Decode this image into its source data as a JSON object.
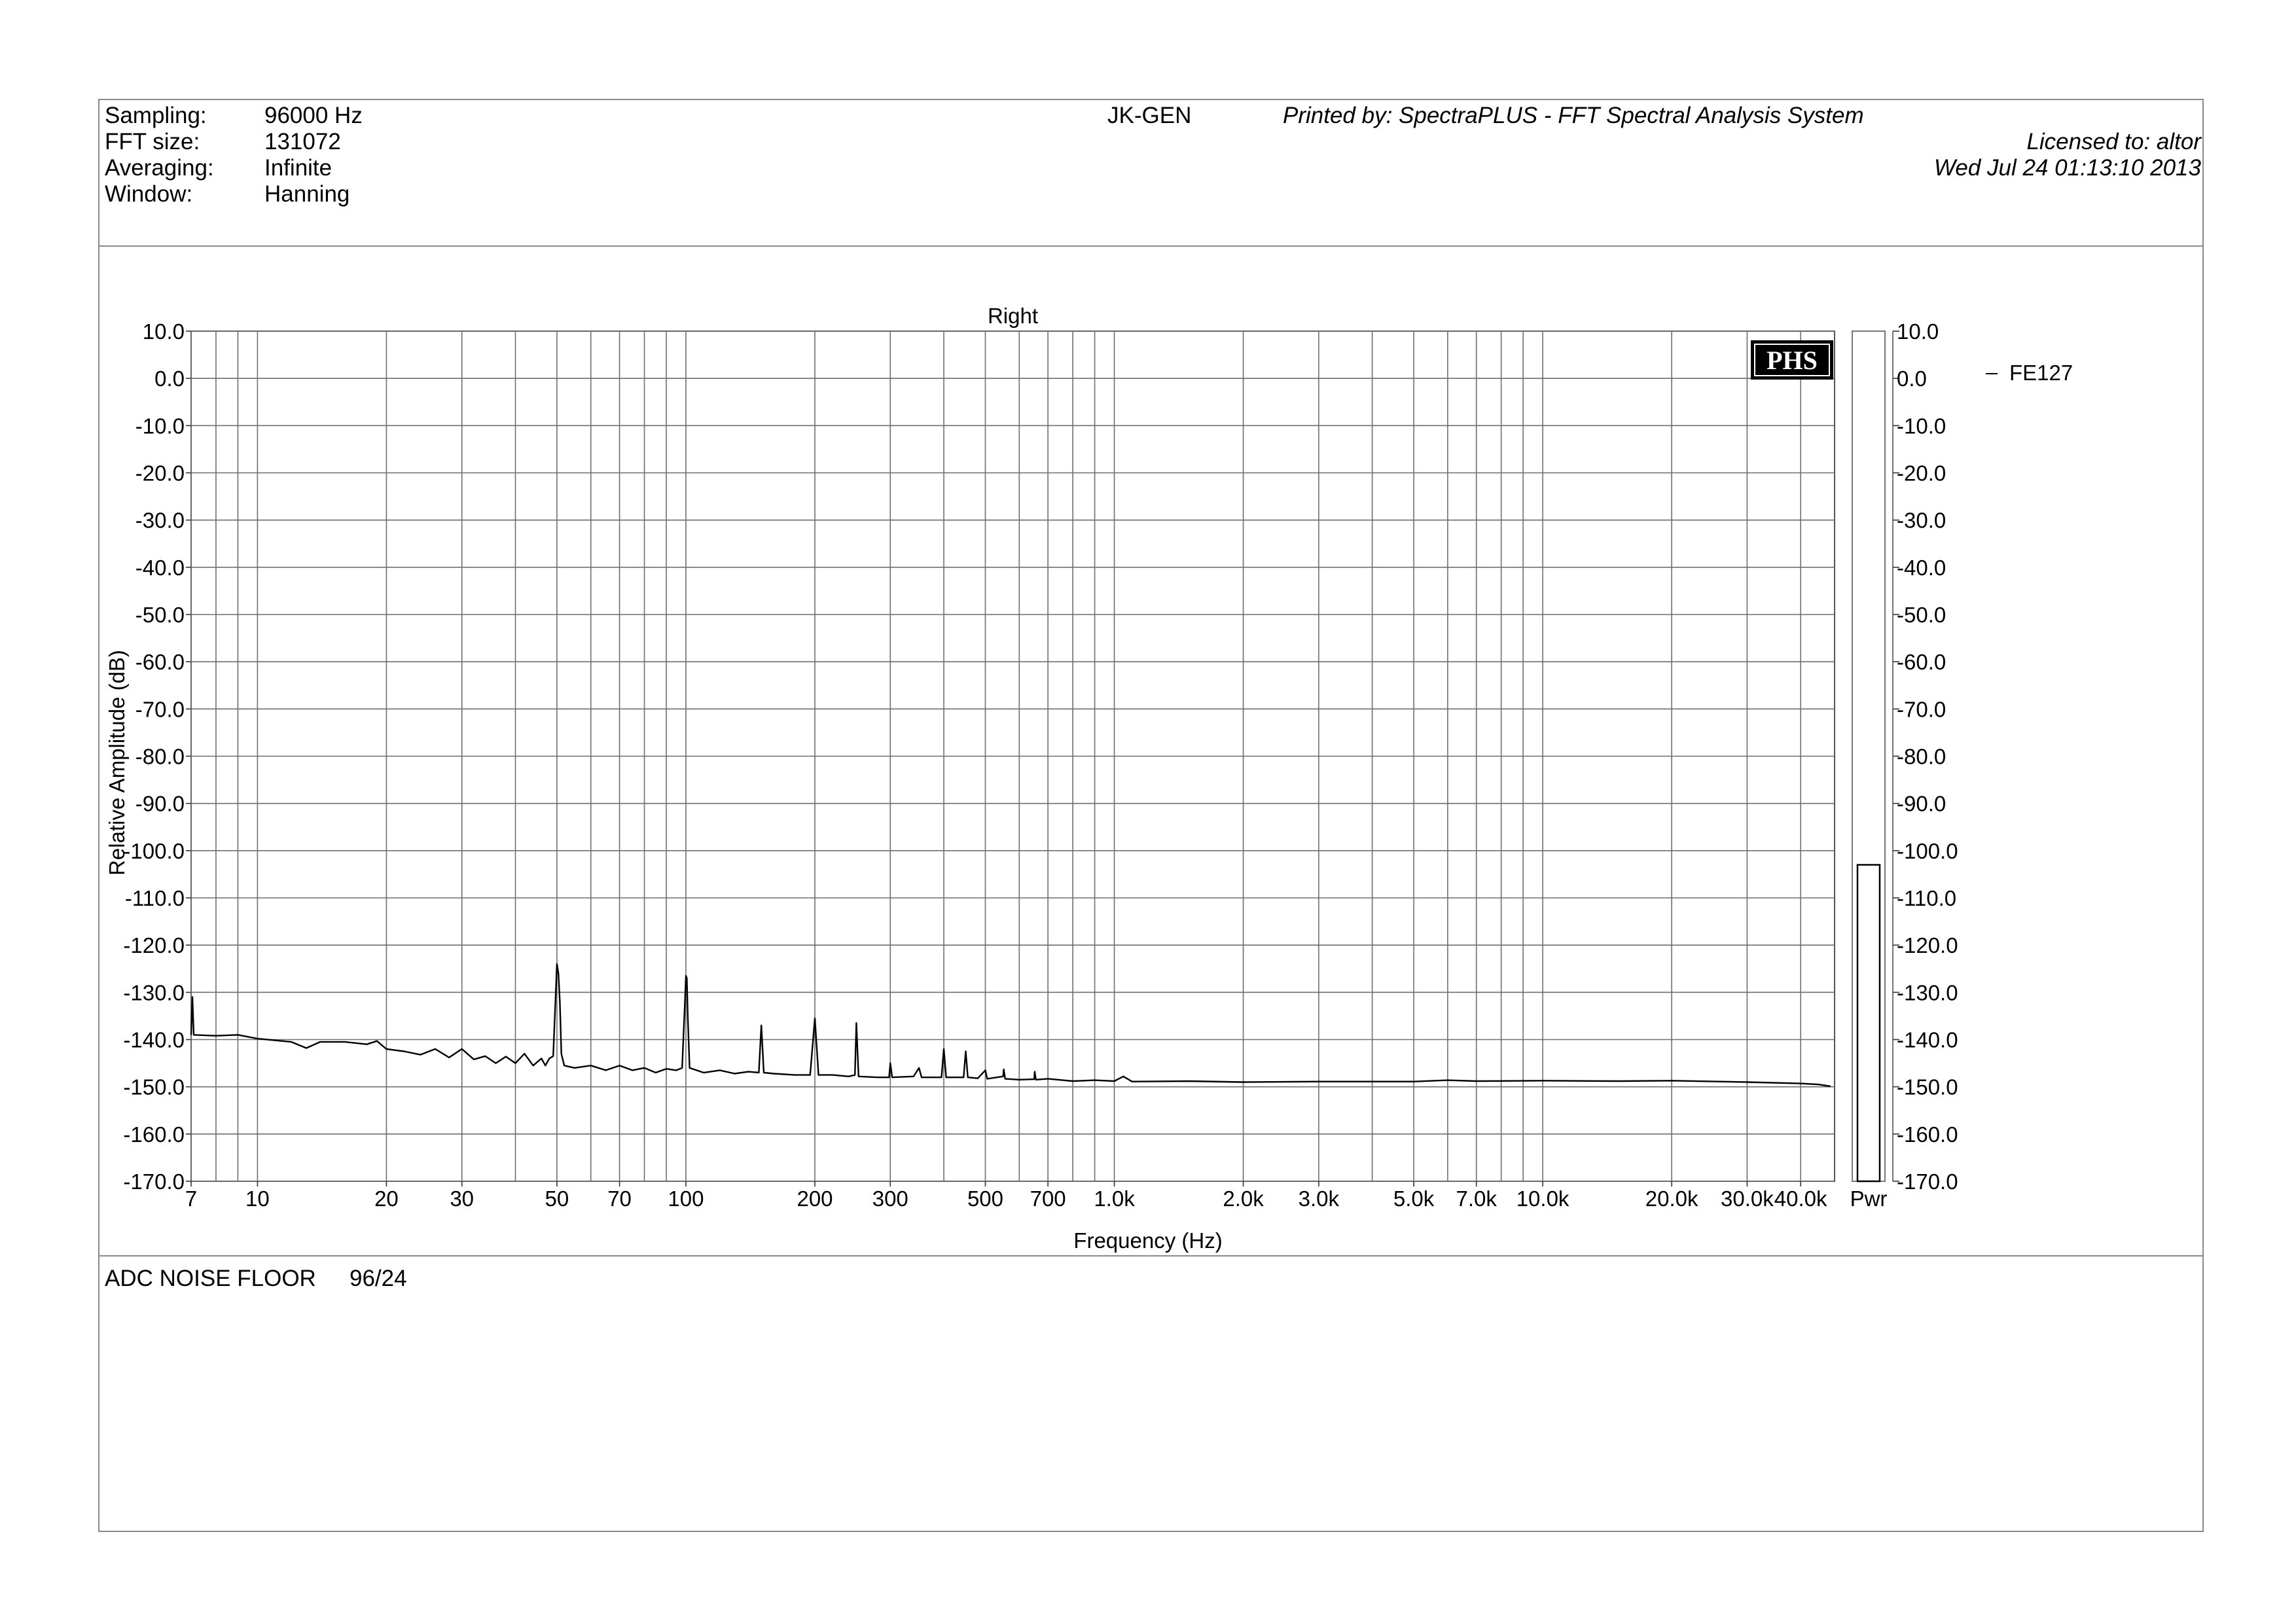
{
  "header": {
    "settings": [
      {
        "label": "Sampling:",
        "value": "96000 Hz"
      },
      {
        "label": "FFT size:",
        "value": "131072"
      },
      {
        "label": "Averaging:",
        "value": "Infinite"
      },
      {
        "label": "Window:",
        "value": "Hanning"
      }
    ],
    "device": "JK-GEN",
    "printed_by": "Printed by: SpectraPLUS - FFT Spectral Analysis System",
    "licensed_to": "Licensed to: altor",
    "timestamp": "Wed Jul 24 01:13:10 2013"
  },
  "footer": {
    "comment_label": "ADC NOISE FLOOR",
    "comment_value": "96/24"
  },
  "logo_text": "PHS",
  "chart_data": {
    "type": "line",
    "title": "Right",
    "xlabel": "Frequency (Hz)",
    "ylabel": "Relative Amplitude (dB)",
    "xscale": "log",
    "xlim": [
      7,
      48000
    ],
    "ylim": [
      -170,
      10
    ],
    "x_ticks": [
      {
        "v": 7,
        "label": "7"
      },
      {
        "v": 10,
        "label": "10"
      },
      {
        "v": 20,
        "label": "20"
      },
      {
        "v": 30,
        "label": "30"
      },
      {
        "v": 50,
        "label": "50"
      },
      {
        "v": 70,
        "label": "70"
      },
      {
        "v": 100,
        "label": "100"
      },
      {
        "v": 200,
        "label": "200"
      },
      {
        "v": 300,
        "label": "300"
      },
      {
        "v": 500,
        "label": "500"
      },
      {
        "v": 700,
        "label": "700"
      },
      {
        "v": 1000,
        "label": "1.0k"
      },
      {
        "v": 2000,
        "label": "2.0k"
      },
      {
        "v": 3000,
        "label": "3.0k"
      },
      {
        "v": 5000,
        "label": "5.0k"
      },
      {
        "v": 7000,
        "label": "7.0k"
      },
      {
        "v": 10000,
        "label": "10.0k"
      },
      {
        "v": 20000,
        "label": "20.0k"
      },
      {
        "v": 30000,
        "label": "30.0k"
      },
      {
        "v": 40000,
        "label": "40.0k"
      }
    ],
    "x_gridlines": [
      7,
      8,
      9,
      10,
      20,
      30,
      40,
      50,
      60,
      70,
      80,
      90,
      100,
      200,
      300,
      400,
      500,
      600,
      700,
      800,
      900,
      1000,
      2000,
      3000,
      4000,
      5000,
      6000,
      7000,
      8000,
      9000,
      10000,
      20000,
      30000,
      40000
    ],
    "y_ticks": [
      "10.0",
      "0.0",
      "-10.0",
      "-20.0",
      "-30.0",
      "-40.0",
      "-50.0",
      "-60.0",
      "-70.0",
      "-80.0",
      "-90.0",
      "-100.0",
      "-110.0",
      "-120.0",
      "-130.0",
      "-140.0",
      "-150.0",
      "-160.0",
      "-170.0"
    ],
    "grid": true,
    "legend": {
      "position": "right",
      "entries": [
        "FE127"
      ]
    },
    "series": [
      {
        "name": "FE127",
        "color": "#000000",
        "points": [
          [
            7,
            -139
          ],
          [
            7.05,
            -131
          ],
          [
            7.1,
            -139
          ],
          [
            8,
            -139.2
          ],
          [
            9,
            -139
          ],
          [
            10,
            -139.8
          ],
          [
            12,
            -140.5
          ],
          [
            13,
            -141.8
          ],
          [
            14,
            -140.5
          ],
          [
            16,
            -140.5
          ],
          [
            18,
            -141
          ],
          [
            19,
            -140.3
          ],
          [
            20,
            -142
          ],
          [
            22,
            -142.5
          ],
          [
            24,
            -143.2
          ],
          [
            26,
            -142
          ],
          [
            28,
            -143.8
          ],
          [
            30,
            -142
          ],
          [
            32,
            -144.2
          ],
          [
            34,
            -143.5
          ],
          [
            36,
            -145
          ],
          [
            38,
            -143.6
          ],
          [
            40,
            -145
          ],
          [
            42,
            -143
          ],
          [
            44,
            -145.5
          ],
          [
            46,
            -144
          ],
          [
            47,
            -145.5
          ],
          [
            48,
            -144
          ],
          [
            49,
            -143.5
          ],
          [
            49.6,
            -132
          ],
          [
            50,
            -124
          ],
          [
            50.4,
            -126
          ],
          [
            50.8,
            -132
          ],
          [
            51.2,
            -143
          ],
          [
            52,
            -145.5
          ],
          [
            55,
            -146
          ],
          [
            60,
            -145.5
          ],
          [
            65,
            -146.5
          ],
          [
            70,
            -145.5
          ],
          [
            75,
            -146.5
          ],
          [
            80,
            -146
          ],
          [
            85,
            -147
          ],
          [
            90,
            -146.2
          ],
          [
            95,
            -146.5
          ],
          [
            98,
            -146
          ],
          [
            99.5,
            -132
          ],
          [
            100,
            -126.5
          ],
          [
            100.5,
            -127
          ],
          [
            101,
            -135
          ],
          [
            102,
            -146
          ],
          [
            110,
            -147
          ],
          [
            120,
            -146.5
          ],
          [
            130,
            -147.2
          ],
          [
            140,
            -146.8
          ],
          [
            148,
            -147
          ],
          [
            150,
            -137
          ],
          [
            152,
            -147
          ],
          [
            160,
            -147.2
          ],
          [
            180,
            -147.5
          ],
          [
            195,
            -147.5
          ],
          [
            200,
            -135.5
          ],
          [
            204,
            -147.5
          ],
          [
            220,
            -147.5
          ],
          [
            240,
            -147.8
          ],
          [
            248,
            -147.5
          ],
          [
            250,
            -136.5
          ],
          [
            253,
            -147.8
          ],
          [
            280,
            -148
          ],
          [
            298,
            -148
          ],
          [
            300,
            -145
          ],
          [
            303,
            -148
          ],
          [
            340,
            -147.8
          ],
          [
            350,
            -146
          ],
          [
            355,
            -148
          ],
          [
            395,
            -148
          ],
          [
            400,
            -142
          ],
          [
            405,
            -148
          ],
          [
            445,
            -148
          ],
          [
            450,
            -142.5
          ],
          [
            455,
            -148
          ],
          [
            480,
            -148.2
          ],
          [
            500,
            -146.5
          ],
          [
            505,
            -148.3
          ],
          [
            550,
            -147.8
          ],
          [
            552,
            -146.3
          ],
          [
            556,
            -148.3
          ],
          [
            600,
            -148.5
          ],
          [
            650,
            -148.4
          ],
          [
            652,
            -146.8
          ],
          [
            656,
            -148.5
          ],
          [
            700,
            -148.3
          ],
          [
            800,
            -148.8
          ],
          [
            900,
            -148.6
          ],
          [
            1000,
            -148.8
          ],
          [
            1050,
            -147.8
          ],
          [
            1100,
            -148.9
          ],
          [
            1500,
            -148.8
          ],
          [
            2000,
            -149
          ],
          [
            3000,
            -148.9
          ],
          [
            5000,
            -148.9
          ],
          [
            6000,
            -148.6
          ],
          [
            7000,
            -148.8
          ],
          [
            10000,
            -148.7
          ],
          [
            15000,
            -148.8
          ],
          [
            20000,
            -148.7
          ],
          [
            30000,
            -149
          ],
          [
            40000,
            -149.3
          ],
          [
            44000,
            -149.5
          ],
          [
            47000,
            -149.9
          ]
        ]
      }
    ],
    "power_bar": {
      "label": "Pwr",
      "level_db": -103,
      "scale": [
        "10.0",
        "0.0",
        "-10.0",
        "-20.0",
        "-30.0",
        "-40.0",
        "-50.0",
        "-60.0",
        "-70.0",
        "-80.0",
        "-90.0",
        "-100.0",
        "-110.0",
        "-120.0",
        "-130.0",
        "-140.0",
        "-150.0",
        "-160.0",
        "-170.0"
      ]
    }
  }
}
